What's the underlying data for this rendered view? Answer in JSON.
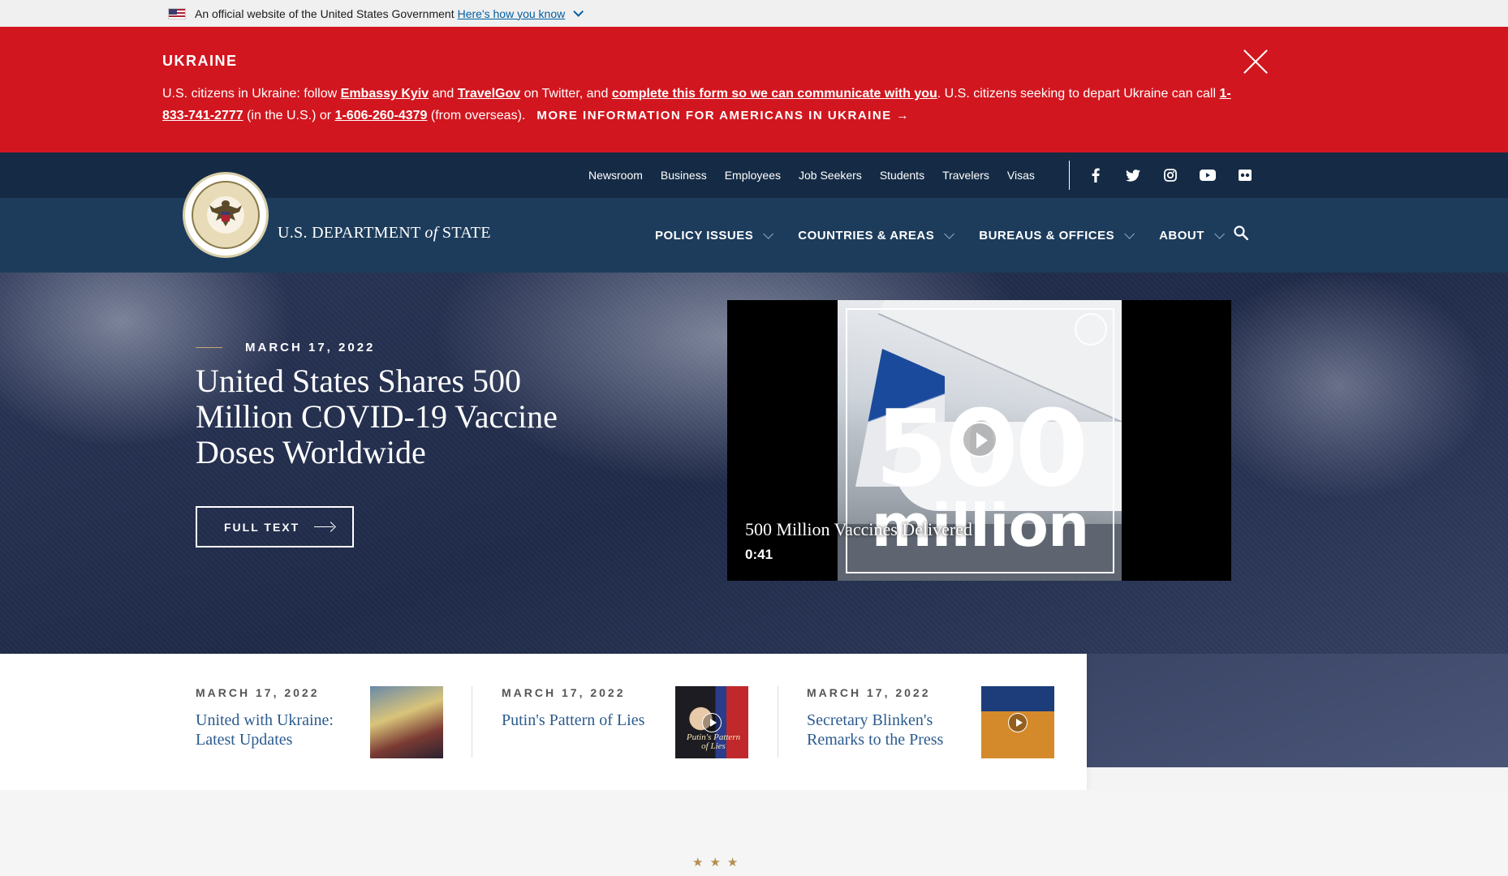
{
  "gov_banner": {
    "text": "An official website of the United States Government",
    "link": "Here's how you know"
  },
  "alert": {
    "title": "UKRAINE",
    "text_1": "U.S. citizens in Ukraine: follow ",
    "link_embassy": "Embassy Kyiv",
    "text_2": " and ",
    "link_travelgov": "TravelGov",
    "text_3": " on Twitter, and ",
    "link_form": "complete this form so we can communicate with you",
    "text_4": ". U.S. citizens seeking to depart Ukraine can call ",
    "phone_us": "1-833-741-2777",
    "text_5": " (in the U.S.) or ",
    "phone_overseas": "1-606-260-4379",
    "text_6": " (from overseas).",
    "more_link": "MORE INFORMATION FOR AMERICANS IN UKRAINE →"
  },
  "utility_nav": [
    "Newsroom",
    "Business",
    "Employees",
    "Job Seekers",
    "Students",
    "Travelers",
    "Visas"
  ],
  "social_icons": [
    "facebook-icon",
    "twitter-icon",
    "instagram-icon",
    "youtube-icon",
    "flickr-icon"
  ],
  "logo": {
    "pre": "U.S. DEPARTMENT ",
    "of": "of",
    "post": " STATE"
  },
  "main_nav": [
    "POLICY ISSUES",
    "COUNTRIES & AREAS",
    "BUREAUS & OFFICES",
    "ABOUT"
  ],
  "hero": {
    "date": "MARCH 17, 2022",
    "title": "United States Shares 500 Million COVID-19 Vaccine Doses Worldwide",
    "button": "FULL TEXT"
  },
  "video": {
    "overlay_number": "500",
    "overlay_word": "million",
    "caption": "500 Million Vaccines Delivered",
    "duration": "0:41"
  },
  "cards": [
    {
      "date": "MARCH 17, 2022",
      "title": "United with Ukraine: Latest Updates"
    },
    {
      "date": "MARCH 17, 2022",
      "title": "Putin's Pattern of Lies",
      "thumb_text": "Putin's Pattern of Lies"
    },
    {
      "date": "MARCH 17, 2022",
      "title": "Secretary Blinken's Remarks to the Press"
    }
  ],
  "stars": "★★★",
  "colors": {
    "alert_red": "#d2161f",
    "header_dark": "#152b45",
    "header_main": "#1d3c5c",
    "link_blue": "#2b5b8f",
    "gold": "#b58e4d"
  }
}
